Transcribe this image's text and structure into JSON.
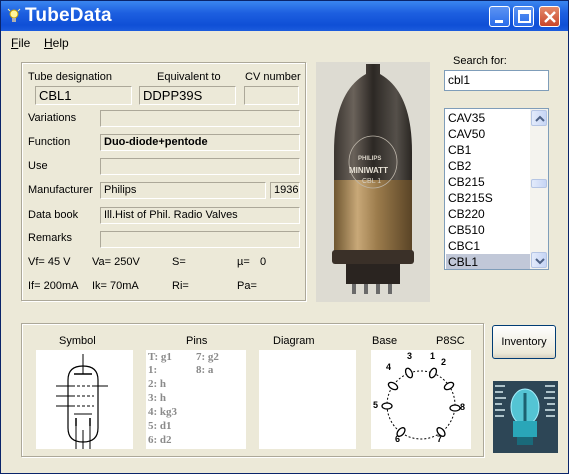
{
  "window": {
    "title": "TubeData",
    "title_icon": "lightbulb-icon",
    "controls": [
      "minimize-icon",
      "maximize-icon",
      "close-icon"
    ]
  },
  "menu": {
    "file": {
      "underline": "F",
      "rest": "ile"
    },
    "help": {
      "underline": "H",
      "rest": "elp"
    }
  },
  "info": {
    "tube_designation_label": "Tube designation",
    "tube_designation_value": "CBL1",
    "equivalent_label": "Equivalent to",
    "equivalent_value": "DDPP39S",
    "cv_label": "CV number",
    "cv_value": "",
    "variations_label": "Variations",
    "variations_value": "",
    "function_label": "Function",
    "function_value": "Duo-diode+pentode",
    "use_label": "Use",
    "use_value": "",
    "manufacturer_label": "Manufacturer",
    "manufacturer_value": "Philips",
    "year_value": "1936",
    "databook_label": "Data book",
    "databook_value": "Ill.Hist of Phil. Radio Valves",
    "remarks_label": "Remarks",
    "remarks_value": ""
  },
  "params": {
    "vf": "Vf= 45 V",
    "va": "Va= 250V",
    "s": "S=",
    "mu": "µ=",
    "mu_value": "0",
    "if": "If= 200mA",
    "ik": "Ik=  70mA",
    "ri": "Ri=",
    "pa": "Pa="
  },
  "photo": {
    "brand": "PHILIPS",
    "model": "MINIWATT",
    "type": "CBL 1"
  },
  "search": {
    "label": "Search for:",
    "value": "cbl1"
  },
  "tube_list": {
    "items": [
      "CAV35",
      "CAV50",
      "CB1",
      "CB2",
      "CB215",
      "CB215S",
      "CB220",
      "CB510",
      "CBC1",
      "CBL1"
    ],
    "selected": "CBL1",
    "scroll_position": 0.75
  },
  "bottom": {
    "symbol_label": "Symbol",
    "pins_label": "Pins",
    "diagram_label": "Diagram",
    "base_label": "Base",
    "base_type": "P8SC",
    "pins_col1": [
      "T: g1",
      "1:",
      "2: h",
      "3: h",
      "4: kg3",
      "5: d1",
      "6: d2"
    ],
    "pins_col2": [
      "7: g2",
      "8: a"
    ],
    "base_pin_numbers": [
      "1",
      "2",
      "3",
      "4",
      "5",
      "6",
      "7",
      "8"
    ]
  },
  "buttons": {
    "inventory": "Inventory"
  },
  "colors": {
    "titlebar": "#0f4fd6",
    "window_bg": "#ece9d8",
    "selection": "#c1c8d8"
  }
}
